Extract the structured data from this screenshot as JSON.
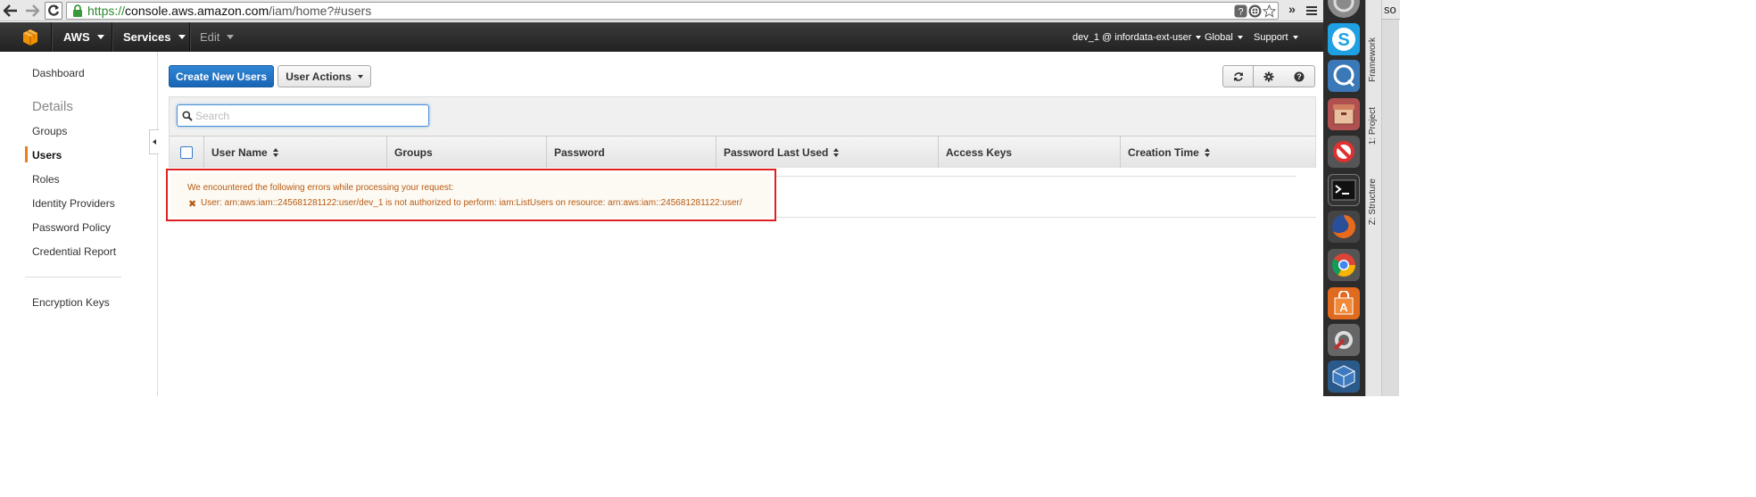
{
  "browser": {
    "url_scheme": "https://",
    "url_host": "console.aws.amazon.com",
    "url_path": "/iam/home?#users",
    "more_label": "»"
  },
  "aws_nav": {
    "brand": "AWS",
    "services": "Services",
    "edit": "Edit",
    "user": "dev_1 @ infordata-ext-user",
    "region": "Global",
    "support": "Support"
  },
  "sidebar": {
    "dashboard": "Dashboard",
    "details_heading": "Details",
    "groups": "Groups",
    "users": "Users",
    "roles": "Roles",
    "identity_providers": "Identity Providers",
    "password_policy": "Password Policy",
    "credential_report": "Credential Report",
    "encryption_keys": "Encryption Keys"
  },
  "toolbar": {
    "create_label": "Create New Users",
    "actions_label": "User Actions"
  },
  "search": {
    "placeholder": "Search"
  },
  "table": {
    "columns": [
      "User Name",
      "Groups",
      "Password",
      "Password Last Used",
      "Access Keys",
      "Creation Time"
    ]
  },
  "error": {
    "title": "We encountered the following errors while processing your request:",
    "icon": "✖",
    "message": "User: arn:aws:iam::245681281122:user/dev_1 is not authorized to perform: iam:ListUsers on resource: arn:aws:iam::245681281122:user/"
  },
  "ide": {
    "framework_label": "Framework",
    "project_label": "1: Project",
    "structure_label": "Z: Structure",
    "tab_label": "so"
  },
  "colors": {
    "primary_button": "#1a65b5",
    "error_border": "#e02020",
    "error_text": "#b85a12",
    "active_marker": "#e8801a"
  }
}
